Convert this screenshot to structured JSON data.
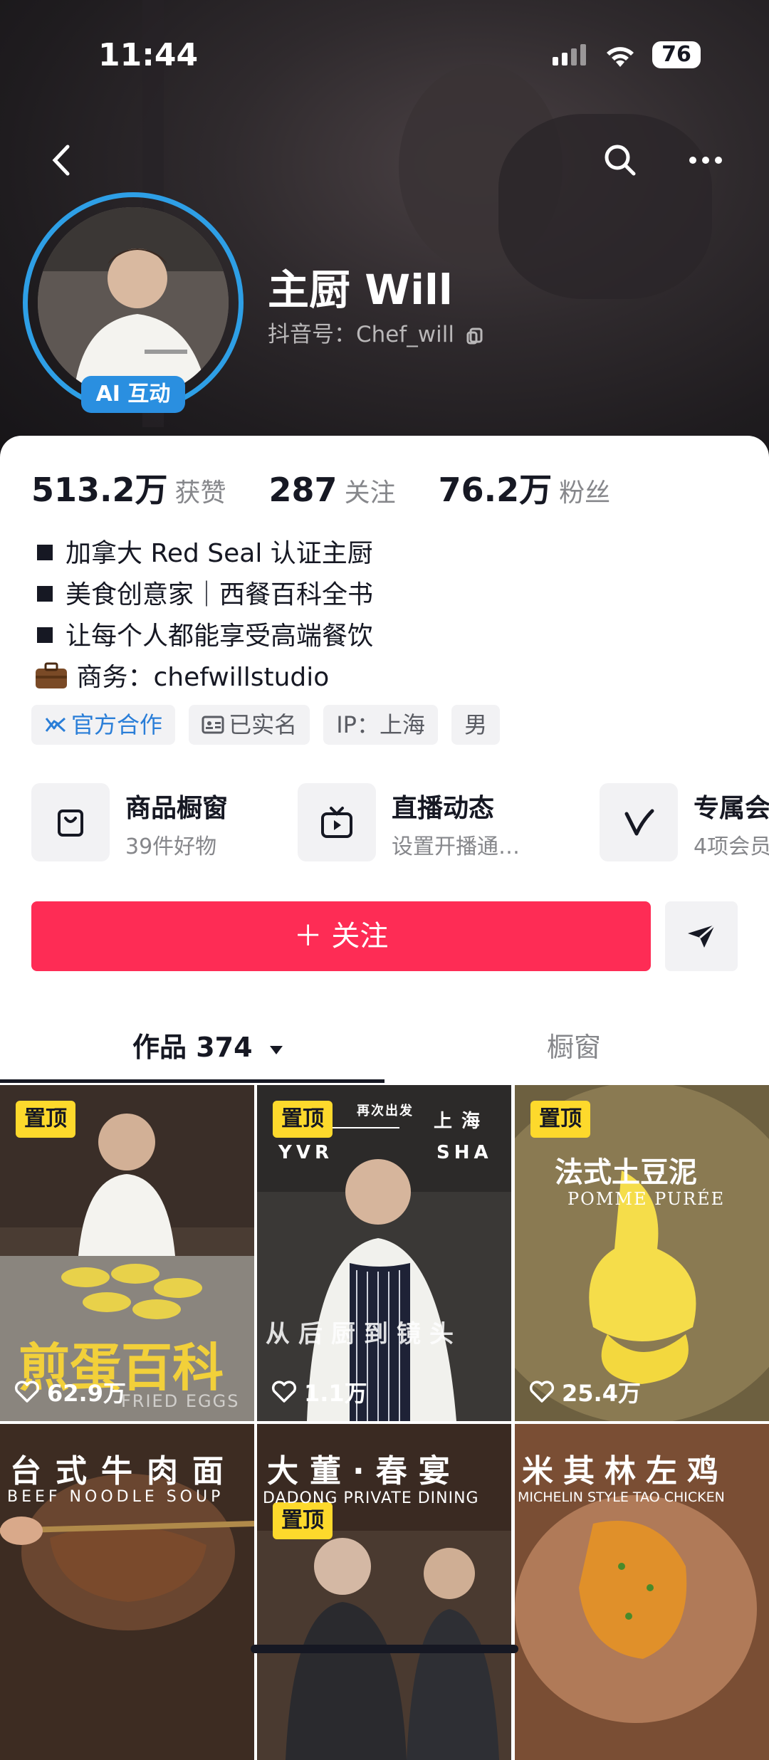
{
  "status_bar": {
    "time": "11:44",
    "battery": "76"
  },
  "profile": {
    "name": "主厨 Will",
    "douyin_id": "抖音号：Chef_will",
    "avatar_badge": "AI 互动"
  },
  "stats": [
    {
      "value": "513.2万",
      "label": "获赞"
    },
    {
      "value": "287",
      "label": "关注"
    },
    {
      "value": "76.2万",
      "label": "粉丝"
    }
  ],
  "bio": [
    "加拿大 Red Seal 认证主厨",
    "美食创意家｜西餐百科全书",
    "让每个人都能享受高端餐饮",
    "商务：chefwillstudio"
  ],
  "tags": [
    "官方合作",
    "已实名",
    "IP：上海",
    "男"
  ],
  "services": [
    {
      "title": "商品橱窗",
      "subtitle": "39件好物",
      "icon": "bag-icon"
    },
    {
      "title": "直播动态",
      "subtitle": "设置开播通…",
      "icon": "tv-icon"
    },
    {
      "title": "专属会",
      "subtitle": "4项会员",
      "icon": "v-icon"
    }
  ],
  "actions": {
    "follow_label": "＋ 关注"
  },
  "tabs": {
    "works": "作品 374",
    "shop": "橱窗"
  },
  "videos": [
    {
      "pinned": "置顶",
      "likes": "62.9万",
      "title": "煎蛋百科",
      "subtitle": "FRIED EGGS",
      "bg": "#5a4a3e"
    },
    {
      "pinned": "置顶",
      "likes": "1.1万",
      "title": "从后厨到镜头",
      "overlay_top": "再次出发",
      "route_from": "YVR",
      "route_to_cn": "上 海",
      "route_to": "SHA",
      "bg": "#3d3b3a"
    },
    {
      "pinned": "置顶",
      "likes": "25.4万",
      "title": "法式土豆泥",
      "subtitle": "POMME PURÉE",
      "bg": "#7a6a48"
    },
    {
      "title": "台式牛肉面",
      "subtitle": "BEEF NOODLE SOUP",
      "bg": "#4a3426"
    },
    {
      "pinned": "置顶",
      "title": "大董·春宴",
      "subtitle": "DADONG PRIVATE DINING",
      "bg": "#4d3f35"
    },
    {
      "title": "米其林左鸡",
      "subtitle": "MICHELIN STYLE TAO CHICKEN",
      "bg": "#8a5a3a"
    }
  ]
}
